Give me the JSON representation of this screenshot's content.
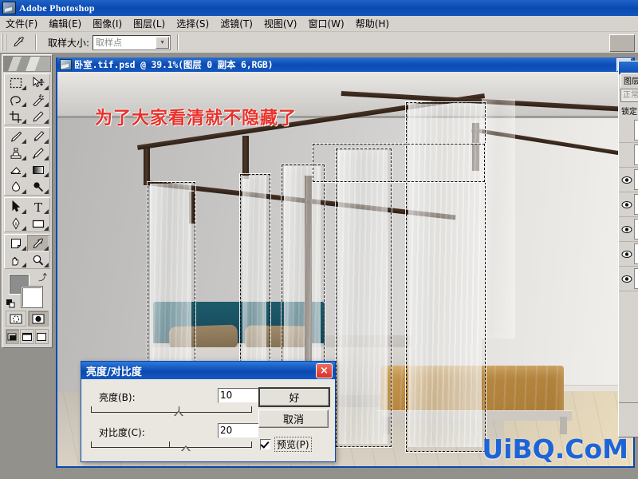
{
  "app": {
    "title": "Adobe Photoshop",
    "icon": "photoshop-icon"
  },
  "menu": {
    "items": [
      {
        "label": "文件(F)"
      },
      {
        "label": "编辑(E)"
      },
      {
        "label": "图像(I)"
      },
      {
        "label": "图层(L)"
      },
      {
        "label": "选择(S)"
      },
      {
        "label": "滤镜(T)"
      },
      {
        "label": "视图(V)"
      },
      {
        "label": "窗口(W)"
      },
      {
        "label": "帮助(H)"
      }
    ]
  },
  "options_bar": {
    "active_tool": "eyedropper-tool",
    "sample_size_label": "取样大小:",
    "sample_size_value": "取样点",
    "palette_well": "palette-well"
  },
  "toolbox": {
    "tools": [
      "rectangular-marquee-tool",
      "move-tool",
      "lasso-tool",
      "magic-wand-tool",
      "crop-tool",
      "slice-tool",
      "healing-brush-tool",
      "brush-tool",
      "clone-stamp-tool",
      "history-brush-tool",
      "eraser-tool",
      "gradient-tool",
      "blur-tool",
      "dodge-tool",
      "path-selection-tool",
      "type-tool",
      "pen-tool",
      "rectangle-tool",
      "notes-tool",
      "eyedropper-tool",
      "hand-tool",
      "zoom-tool"
    ],
    "foreground_color": "#8d8d8d",
    "background_color": "#ffffff",
    "mask_modes": [
      "standard-mask-mode",
      "quick-mask-mode"
    ],
    "screen_modes": [
      "standard-screen-mode",
      "full-screen-with-menu-mode",
      "full-screen-mode"
    ]
  },
  "document": {
    "title": "卧室.tif.psd @ 39.1%(图层 0 副本 6,RGB)",
    "zoom": "39.1%",
    "layer_name": "图层 0 副本 6",
    "color_mode": "RGB",
    "minimize_label": "minimize-button"
  },
  "canvas": {
    "annotation_text": "为了大家看清就不隐藏了",
    "annotation_color": "#e8312a",
    "watermark_text": "UiBQ.CoM",
    "watermark_color": "#1d64d8",
    "scene": "四柱床卧室效果图（窗帘选区虚线）"
  },
  "layers_panel": {
    "tab_label": "图层",
    "blend_mode": "正常",
    "lock_label": "锁定",
    "rows": [
      {
        "visible": true
      },
      {
        "visible": true
      },
      {
        "visible": true
      },
      {
        "visible": true
      },
      {
        "visible": true
      },
      {
        "visible": true
      }
    ]
  },
  "dialog": {
    "title": "亮度/对比度",
    "close_icon": "×",
    "fields": [
      {
        "label": "亮度(B):",
        "value": "10",
        "slider_percent": 55
      },
      {
        "label": "对比度(C):",
        "value": "20",
        "slider_percent": 60
      }
    ],
    "buttons": {
      "ok": "好",
      "cancel": "取消"
    },
    "preview": {
      "label": "预览(P)",
      "checked": true
    }
  }
}
